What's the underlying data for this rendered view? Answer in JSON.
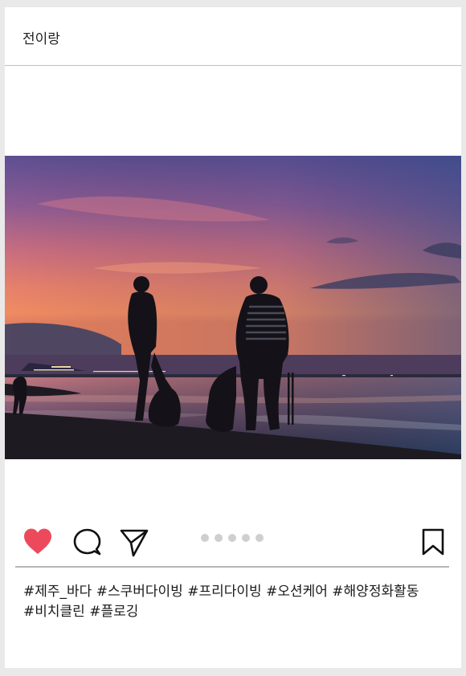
{
  "post": {
    "username": "전이랑",
    "photo_alt": "",
    "hashtags": [
      "#제주_바다",
      "#스쿠버다이빙",
      "#프리다이빙",
      "#오션케어",
      "#해양정화활동",
      "#비치클린",
      "#플로깅"
    ]
  },
  "actions": {
    "like_icon": "heart-icon",
    "comment_icon": "comment-bubble-icon",
    "share_icon": "paper-plane-icon",
    "save_icon": "bookmark-icon",
    "liked": true,
    "carousel_total": 5,
    "carousel_active": 0
  },
  "colors": {
    "like": "#ec4a5c",
    "icon": "#111111",
    "dot": "#cfcfcf",
    "divider": "#b5b5b5"
  }
}
